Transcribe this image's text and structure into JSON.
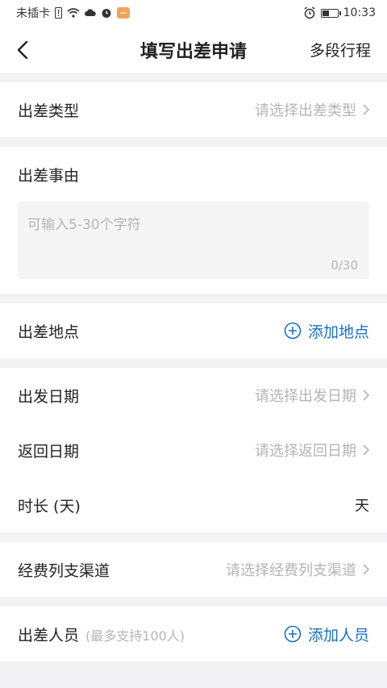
{
  "status_bar": {
    "carrier": "未插卡",
    "time": "10:33"
  },
  "header": {
    "title": "填写出差申请",
    "right_action": "多段行程"
  },
  "form": {
    "trip_type": {
      "label": "出差类型",
      "placeholder": "请选择出差类型"
    },
    "trip_reason": {
      "label": "出差事由",
      "placeholder": "可输入5-30个字符",
      "counter": "0/30"
    },
    "trip_location": {
      "label": "出差地点",
      "action": "添加地点"
    },
    "depart_date": {
      "label": "出发日期",
      "placeholder": "请选择出发日期"
    },
    "return_date": {
      "label": "返回日期",
      "placeholder": "请选择返回日期"
    },
    "duration": {
      "label": "时长 (天)",
      "unit": "天"
    },
    "expense_channel": {
      "label": "经费列支渠道",
      "placeholder": "请选择经费列支渠道"
    },
    "travelers": {
      "label": "出差人员",
      "hint": "(最多支持100人)",
      "action": "添加人员"
    }
  },
  "colors": {
    "accent": "#1a6fc4",
    "placeholder": "#b5b5b5",
    "background": "#f3f3f5"
  }
}
